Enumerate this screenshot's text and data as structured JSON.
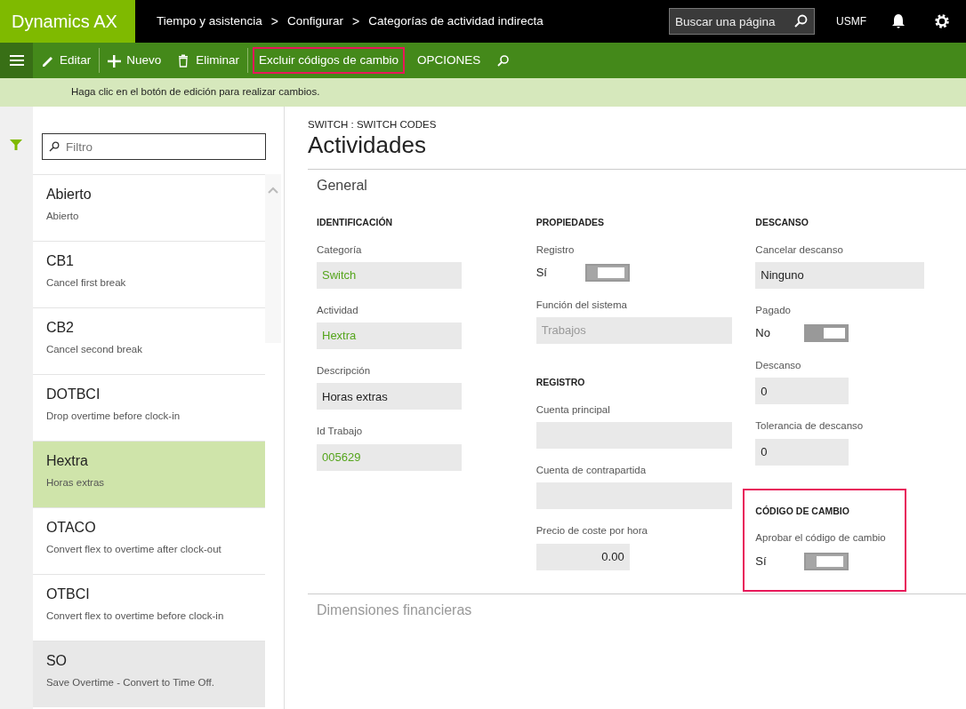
{
  "app": {
    "brand": "Dynamics AX",
    "breadcrumbs": [
      "Tiempo y asistencia",
      "Configurar",
      "Categorías de actividad indirecta"
    ],
    "separator": ">",
    "search": {
      "placeholder": "Buscar una página"
    },
    "company": "USMF"
  },
  "toolbar": [
    {
      "kind": "edit",
      "label": "Editar",
      "highlighted": false
    },
    {
      "kind": "new",
      "label": "Nuevo",
      "highlighted": false
    },
    {
      "kind": "delete",
      "label": "Eliminar",
      "highlighted": false
    },
    {
      "kind": "plain",
      "label": "Excluir códigos de cambio",
      "highlighted": true
    },
    {
      "kind": "plain",
      "label": "OPCIONES",
      "highlighted": false
    },
    {
      "kind": "search",
      "highlighted": false
    }
  ],
  "message": "Haga clic en el botón de edición para realizar cambios.",
  "list": {
    "filter": {
      "placeholder": "Filtro"
    },
    "items": [
      {
        "title": "Abierto",
        "subtitle": "Abierto",
        "selected": false,
        "hovered": false
      },
      {
        "title": "CB1",
        "subtitle": "Cancel first break",
        "selected": false,
        "hovered": false
      },
      {
        "title": "CB2",
        "subtitle": "Cancel second break",
        "selected": false,
        "hovered": false
      },
      {
        "title": "DOTBCI",
        "subtitle": "Drop overtime before clock-in",
        "selected": false,
        "hovered": false
      },
      {
        "title": "Hextra",
        "subtitle": "Horas extras",
        "selected": true,
        "hovered": false
      },
      {
        "title": "OTACO",
        "subtitle": "Convert flex to overtime after clock-out",
        "selected": false,
        "hovered": false
      },
      {
        "title": "OTBCI",
        "subtitle": "Convert flex to overtime before clock-in",
        "selected": false,
        "hovered": false
      },
      {
        "title": "SO",
        "subtitle": "Save Overtime - Convert to Time Off.",
        "selected": false,
        "hovered": true
      }
    ]
  },
  "detail": {
    "caption": "SWITCH : SWITCH CODES",
    "title": "Actividades",
    "sections": [
      {
        "title": "General",
        "expanded": true,
        "columns": [
          [
            {
              "heading": "IDENTIFICACIÓN",
              "highlighted": false,
              "fields": [
                {
                  "label": "Categoría",
                  "kind": "link",
                  "value": "Switch"
                },
                {
                  "label": "Actividad",
                  "kind": "link",
                  "value": "Hextra"
                },
                {
                  "label": "Descripción",
                  "kind": "text",
                  "value": "Horas extras"
                },
                {
                  "label": "Id Trabajo",
                  "kind": "link",
                  "value": "005629"
                }
              ]
            }
          ],
          [
            {
              "heading": "PROPIEDADES",
              "highlighted": false,
              "fields": [
                {
                  "label": "Registro",
                  "kind": "toggle",
                  "value": "Sí",
                  "on": true
                },
                {
                  "label": "Función del sistema",
                  "kind": "disabled",
                  "value": "Trabajos"
                }
              ]
            },
            {
              "heading": "REGISTRO",
              "highlighted": false,
              "fields": [
                {
                  "label": "Cuenta principal",
                  "kind": "text"
                },
                {
                  "label": "Cuenta de contrapartida",
                  "kind": "text"
                },
                {
                  "label": "Precio de coste por hora",
                  "kind": "number",
                  "value": "0.00"
                }
              ]
            }
          ],
          [
            {
              "heading": "DESCANSO",
              "highlighted": false,
              "fields": [
                {
                  "label": "Cancelar descanso",
                  "kind": "text",
                  "value": "Ninguno"
                },
                {
                  "label": "Pagado",
                  "kind": "toggle",
                  "value": "No",
                  "on": false
                },
                {
                  "label": "Descanso",
                  "kind": "text",
                  "value": "0"
                },
                {
                  "label": "Tolerancia de descanso",
                  "kind": "text",
                  "value": "0"
                }
              ]
            },
            {
              "heading": "CÓDIGO DE CAMBIO",
              "highlighted": true,
              "fields": [
                {
                  "label": "Aprobar el código de cambio",
                  "kind": "toggle",
                  "value": "Sí",
                  "on": true
                }
              ]
            }
          ]
        ]
      },
      {
        "title": "Dimensiones financieras",
        "expanded": false
      }
    ]
  }
}
